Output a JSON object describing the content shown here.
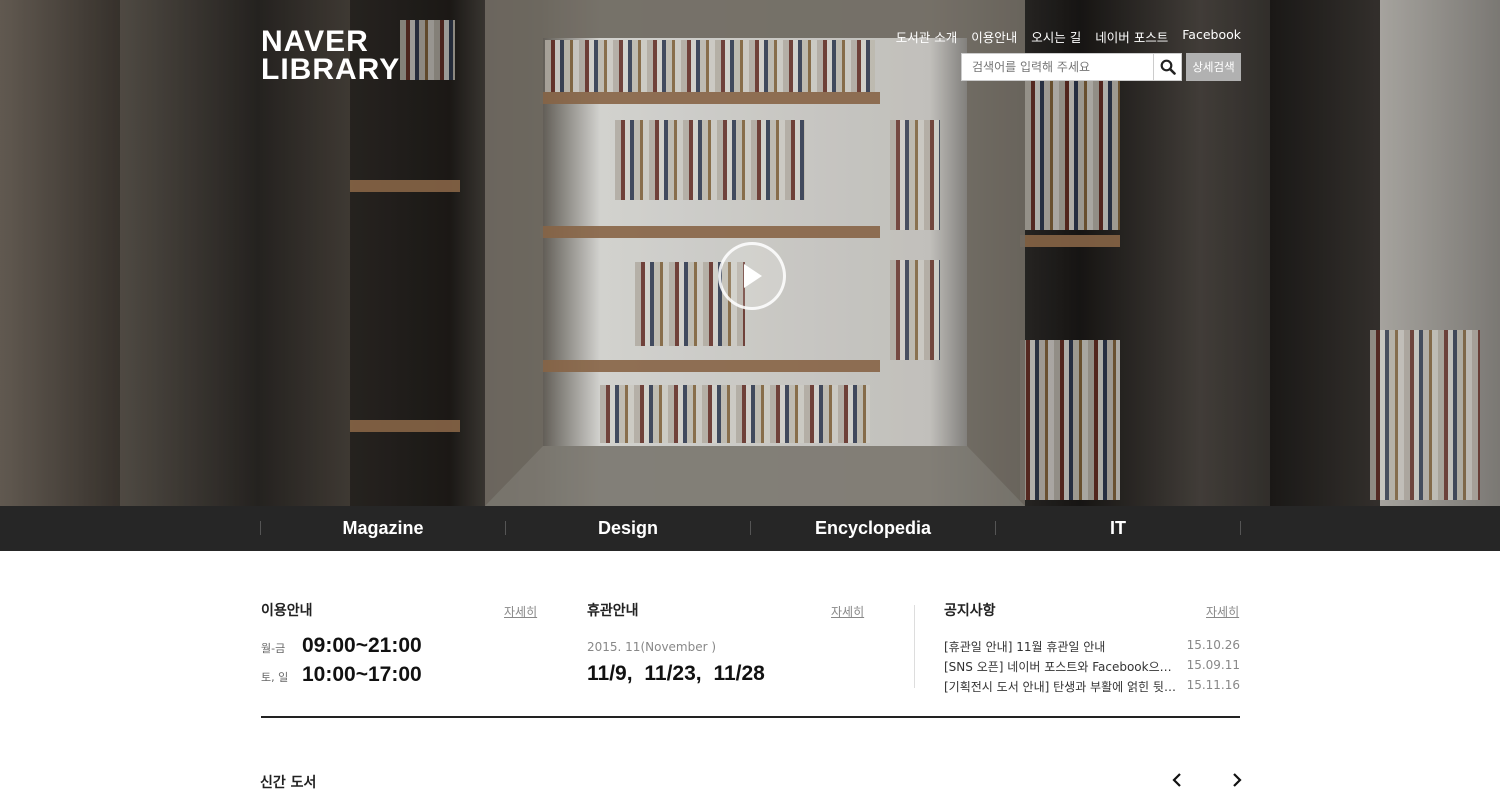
{
  "logo": {
    "line1": "NAVER",
    "line2": "LIBRARY"
  },
  "topnav": [
    "도서관 소개",
    "이용안내",
    "오시는 길",
    "네이버 포스트",
    "Facebook"
  ],
  "search": {
    "placeholder": "검색어를 입력해 주세요",
    "button_icon": "search-icon",
    "advanced_label": "상세검색"
  },
  "hero": {
    "play_icon": "play-icon"
  },
  "categories": [
    "Magazine",
    "Design",
    "Encyclopedia",
    "IT"
  ],
  "usage": {
    "title": "이용안내",
    "more": "자세히",
    "rows": [
      {
        "day": "월-금",
        "time": "09:00~21:00"
      },
      {
        "day": "토, 일",
        "time": "10:00~17:00"
      }
    ]
  },
  "closure": {
    "title": "휴관안내",
    "more": "자세히",
    "month": "2015. 11(November )",
    "days": "11/9, 11/23, 11/28"
  },
  "notices": {
    "title": "공지사항",
    "more": "자세히",
    "items": [
      {
        "title": "[휴관일 안내] 11월 휴관일 안내",
        "date": "15.10.26"
      },
      {
        "title": "[SNS 오픈] 네이버 포스트와 Facebook으로 만나보세요",
        "date": "15.09.11"
      },
      {
        "title": "[기획전시 도서 안내] 탄생과 부활에 얽힌 뒷이야기",
        "date": "15.11.16"
      }
    ]
  },
  "new_books": {
    "title": "신간 도서",
    "prev_icon": "chevron-left-icon",
    "next_icon": "chevron-right-icon"
  }
}
